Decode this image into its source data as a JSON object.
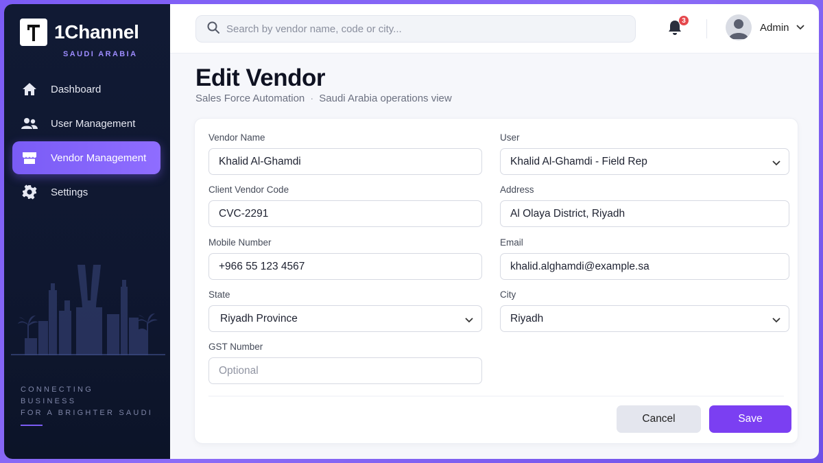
{
  "brand": {
    "name": "1Channel",
    "subtitle": "SAUDI ARABIA"
  },
  "sidebar": {
    "items": [
      {
        "label": "Dashboard",
        "icon": "home-icon",
        "active": false
      },
      {
        "label": "User Management",
        "icon": "users-icon",
        "active": false
      },
      {
        "label": "Vendor Management",
        "icon": "store-icon",
        "active": true
      },
      {
        "label": "Settings",
        "icon": "gear-icon",
        "active": false
      }
    ],
    "tagline": [
      "CONNECTING",
      "BUSINESS",
      "FOR A BRIGHTER SAUDI"
    ]
  },
  "topbar": {
    "search_placeholder": "Search by vendor name, code or city...",
    "notification_count": "3",
    "user_name": "Admin"
  },
  "page": {
    "title": "Edit Vendor",
    "breadcrumb": [
      "Sales Force Automation",
      "Saudi Arabia operations view"
    ]
  },
  "form": {
    "vendor_name": {
      "label": "Vendor Name",
      "value": "Khalid Al-Ghamdi"
    },
    "user": {
      "label": "User",
      "value": "Khalid Al-Ghamdi - Field Rep"
    },
    "client_vendor_code": {
      "label": "Client Vendor Code",
      "value": "CVC-2291"
    },
    "address": {
      "label": "Address",
      "value": "Al Olaya District, Riyadh"
    },
    "mobile_number": {
      "label": "Mobile Number",
      "value": "+966 55 123 4567"
    },
    "email": {
      "label": "Email",
      "value": "khalid.alghamdi@example.sa"
    },
    "state": {
      "label": "State",
      "value": "Riyadh Province"
    },
    "city": {
      "label": "City",
      "value": "Riyadh"
    },
    "gst_number": {
      "label": "GST Number",
      "value": "",
      "placeholder": "Optional"
    }
  },
  "actions": {
    "cancel_label": "Cancel",
    "save_label": "Save"
  },
  "colors": {
    "accent": "#7b3ff2",
    "sidebar_bg": "#111a34",
    "badge": "#e5484d"
  }
}
